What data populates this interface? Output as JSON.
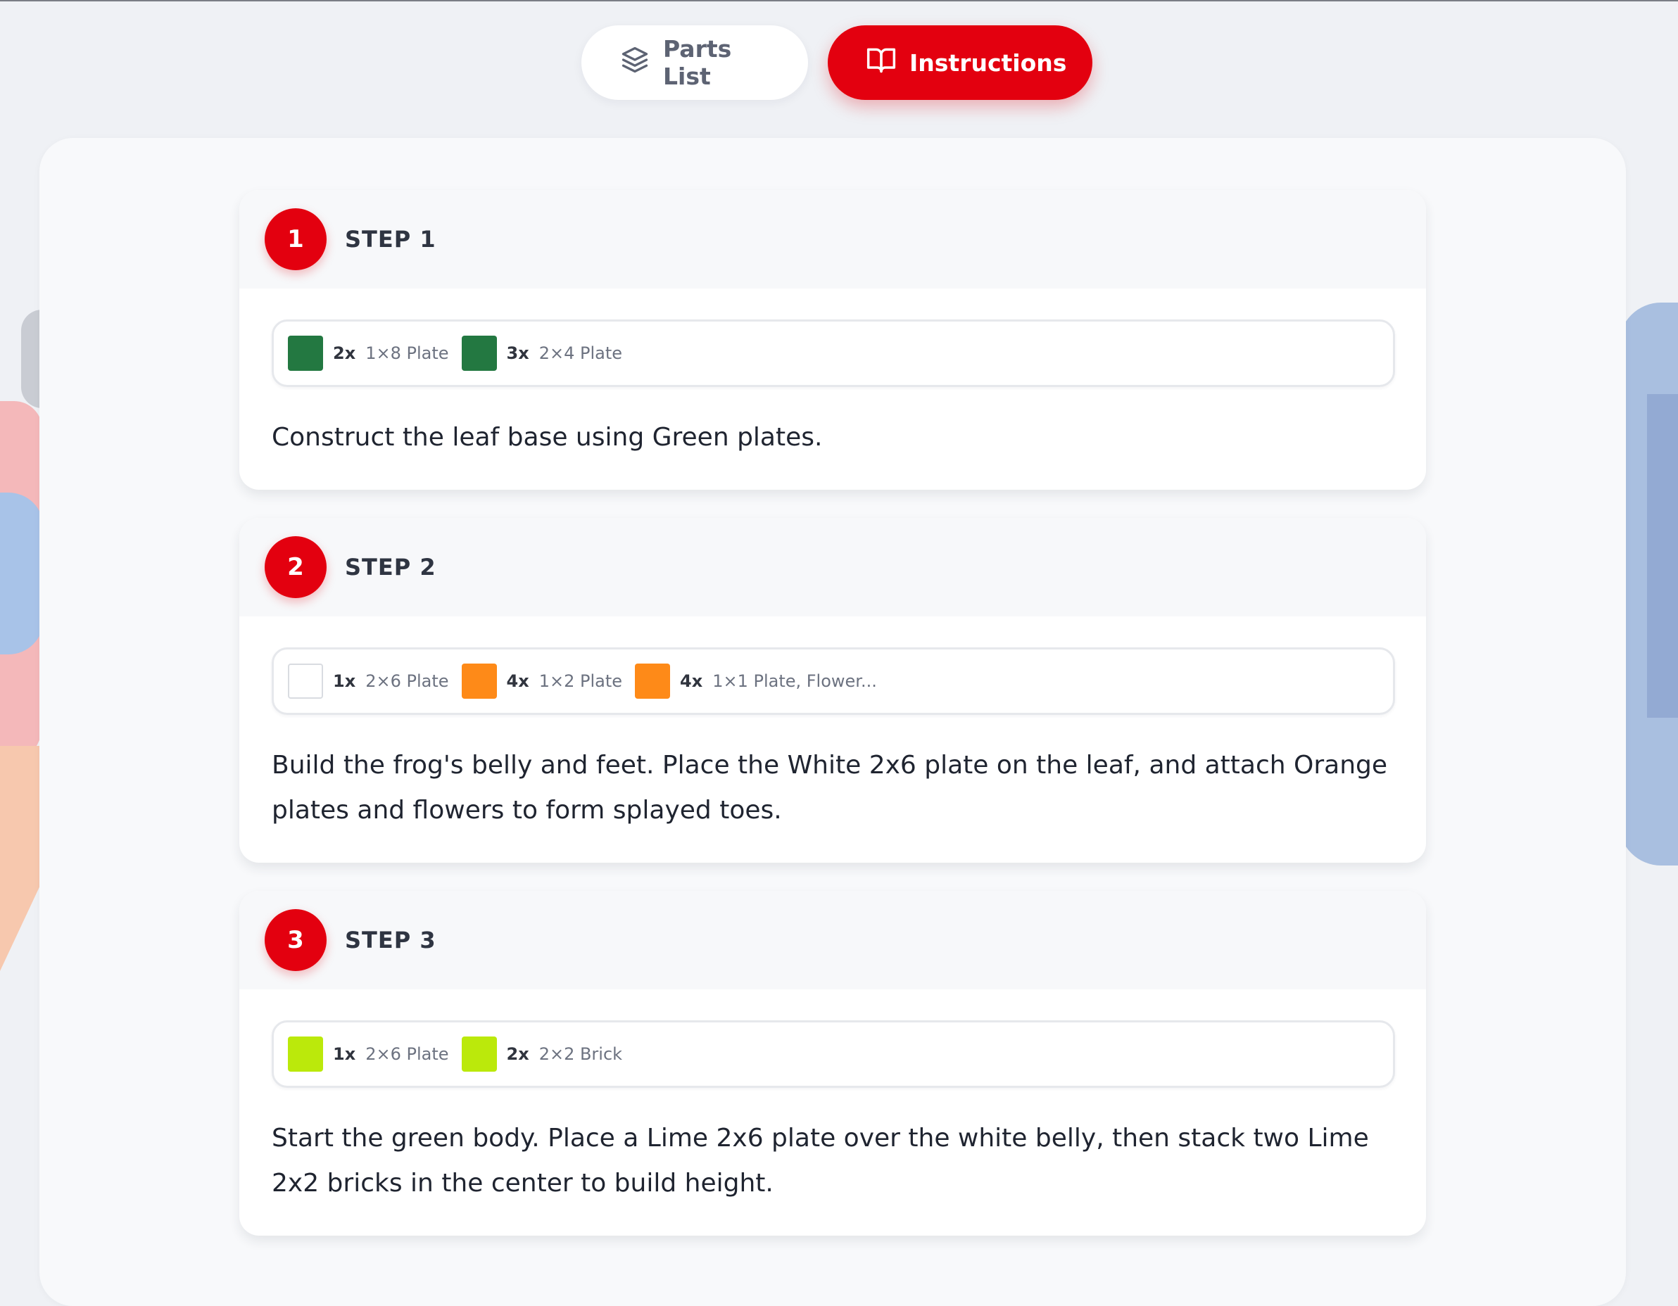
{
  "tabs": {
    "parts_list": {
      "label": "Parts List",
      "icon": "layers-icon"
    },
    "instructions": {
      "label": "Instructions",
      "icon": "book-icon",
      "active": true
    }
  },
  "accent_color": "#e3000f",
  "steps": [
    {
      "number": "1",
      "title": "STEP 1",
      "parts": [
        {
          "qty": "2x",
          "name": "1×8 Plate",
          "color": "#237841"
        },
        {
          "qty": "3x",
          "name": "2×4 Plate",
          "color": "#237841"
        }
      ],
      "description": "Construct the leaf base using Green plates."
    },
    {
      "number": "2",
      "title": "STEP 2",
      "parts": [
        {
          "qty": "1x",
          "name": "2×6 Plate",
          "color": "#ffffff"
        },
        {
          "qty": "4x",
          "name": "1×2 Plate",
          "color": "#fe8a18"
        },
        {
          "qty": "4x",
          "name": "1×1 Plate, Flower...",
          "color": "#fe8a18"
        }
      ],
      "description": "Build the frog's belly and feet. Place the White 2x6 plate on the leaf, and attach Orange plates and flowers to form splayed toes."
    },
    {
      "number": "3",
      "title": "STEP 3",
      "parts": [
        {
          "qty": "1x",
          "name": "2×6 Plate",
          "color": "#bbe90b"
        },
        {
          "qty": "2x",
          "name": "2×2 Brick",
          "color": "#bbe90b"
        }
      ],
      "description": "Start the green body. Place a Lime 2x6 plate over the white belly, then stack two Lime 2x2 bricks in the center to build height."
    }
  ]
}
